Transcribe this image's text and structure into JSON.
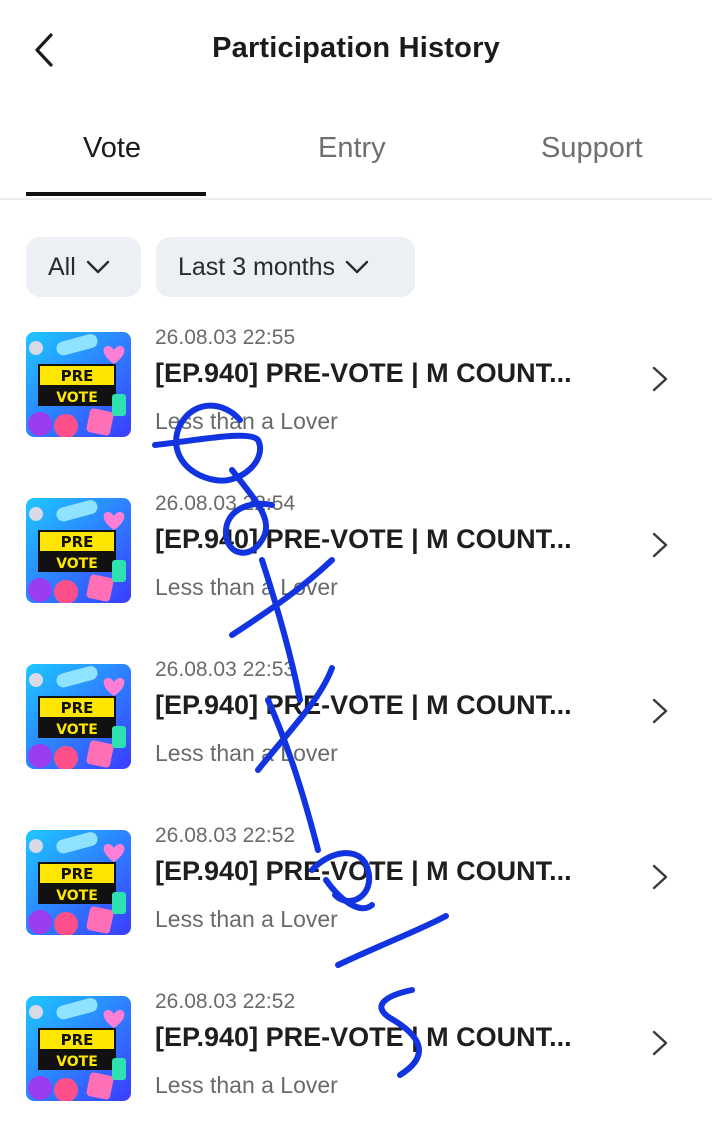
{
  "header": {
    "title": "Participation History",
    "back_icon": "chevron-left-icon"
  },
  "tabs": [
    {
      "label": "Vote",
      "active": true
    },
    {
      "label": "Entry",
      "active": false
    },
    {
      "label": "Support",
      "active": false
    }
  ],
  "filters": {
    "type": {
      "value": "All",
      "icon": "chevron-down-icon"
    },
    "period": {
      "value": "Last 3 months",
      "icon": "chevron-down-icon"
    }
  },
  "thumbnail": {
    "line1": "PRE",
    "line2": "VOTE"
  },
  "items": [
    {
      "time": "26.08.03 22:55",
      "title": "[EP.940] PRE-VOTE | M COUNT...",
      "subtitle": "Less than a Lover"
    },
    {
      "time": "26.08.03 22:54",
      "title": "[EP.940] PRE-VOTE | M COUNT...",
      "subtitle": "Less than a Lover"
    },
    {
      "time": "26.08.03 22:53",
      "title": "[EP.940] PRE-VOTE | M COUNT...",
      "subtitle": "Less than a Lover"
    },
    {
      "time": "26.08.03 22:52",
      "title": "[EP.940] PRE-VOTE | M COUNT...",
      "subtitle": "Less than a Lover"
    },
    {
      "time": "26.08.03 22:52",
      "title": "[EP.940] PRE-VOTE | M COUNT...",
      "subtitle": "Less than a Lover"
    }
  ],
  "colors": {
    "text_primary": "#1e1e1e",
    "text_secondary": "#6a6a6a",
    "filter_bg": "#eceff3",
    "tab_indicator": "#111111",
    "scribble": "#1234e0"
  }
}
